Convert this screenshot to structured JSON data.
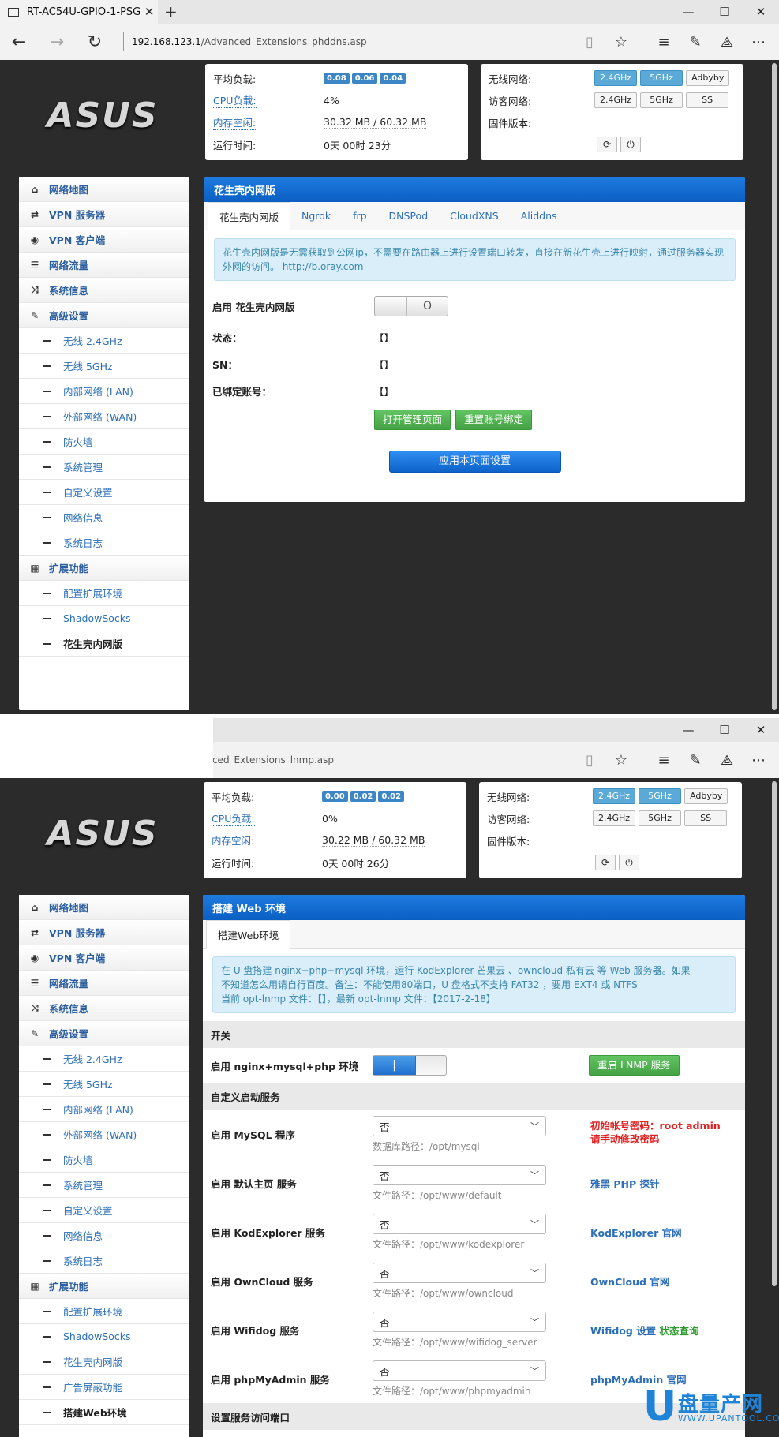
{
  "win1": {
    "tab_title": "RT-AC54U-GPIO-1-PSG",
    "url_host": "192.168.123.1",
    "url_path": "/Advanced_Extensions_phddns.asp",
    "logo": "ASUS",
    "status": {
      "load_label": "平均负载:",
      "load": [
        "0.08",
        "0.06",
        "0.04"
      ],
      "cpu_label": "CPU负载:",
      "cpu": "4%",
      "mem_label": "内存空闲:",
      "mem": "30.32 MB / 60.32 MB",
      "uptime_label": "运行时间:",
      "uptime": "0天 00时 23分"
    },
    "net": {
      "wireless_label": "无线网络:",
      "guest_label": "访客网络:",
      "fw_label": "固件版本:",
      "btn_24": "2.4GHz",
      "btn_5": "5GHz",
      "btn_adbyby": "Adbyby",
      "btn_ss": "SS"
    },
    "panel_title": "花生壳内网版",
    "tabs": [
      "花生壳内网版",
      "Ngrok",
      "frp",
      "DNSPod",
      "CloudXNS",
      "Aliddns"
    ],
    "info": "花生壳内网版是无需获取到公网ip，不需要在路由器上进行设置端口转发，直接在新花生壳上进行映射，通过服务器实现外网的访问。 http://b.oray.com",
    "enable_label": "启用 花生壳内网版",
    "toggle_off": "O",
    "status_label": "状态：",
    "sn_label": "SN：",
    "bound_label": "已绑定账号：",
    "bracket": "【】",
    "btn_open": "打开管理页面",
    "btn_reset": "重置账号绑定",
    "btn_apply": "应用本页面设置"
  },
  "win2": {
    "url_path": "anced_Extensions_lnmp.asp",
    "logo": "ASUS",
    "status": {
      "load": [
        "0.00",
        "0.02",
        "0.02"
      ],
      "cpu": "0%",
      "mem": "30.22 MB / 60.32 MB",
      "uptime": "0天 00时 26分"
    },
    "panel_title": "搭建 Web 环境",
    "tab": "搭建Web环境",
    "info_lines": [
      "在 U 盘搭建 nginx+php+mysql 环境，运行 KodExplorer 芒果云 、owncloud 私有云 等 Web 服务器。如果",
      "不知道怎么用请自行百度。备注：不能使用80端口，U 盘格式不支持 FAT32 ，要用 EXT4 或 NTFS",
      "当前 opt-lnmp 文件：【】，最新 opt-lnmp 文件：【2017-2-18】"
    ],
    "section_switch": "开关",
    "enable_label": "启用 nginx+mysql+php 环境",
    "toggle_on": "|",
    "btn_restart": "重启 LNMP 服务",
    "section_custom": "自定义启动服务",
    "section_port": "设置服务访问端口",
    "services": [
      {
        "label": "启用 MySQL 程序",
        "value": "否",
        "path": "数据库路径：/opt/mysql",
        "link": "初始帐号密码：root admin",
        "link2": "请手动修改密码"
      },
      {
        "label": "启用 默认主页 服务",
        "value": "否",
        "path": "文件路径：/opt/www/default",
        "link": "雅黑 PHP 探针"
      },
      {
        "label": "启用 KodExplorer 服务",
        "value": "否",
        "path": "文件路径：/opt/www/kodexplorer",
        "link": "KodExplorer 官网"
      },
      {
        "label": "启用 OwnCloud 服务",
        "value": "否",
        "path": "文件路径：/opt/www/owncloud",
        "link": "OwnCloud 官网"
      },
      {
        "label": "启用 Wifidog 服务",
        "value": "否",
        "path": "文件路径：/opt/www/wifidog_server",
        "link": "Wifidog 设置",
        "link2": "状态查询"
      },
      {
        "label": "启用 phpMyAdmin 服务",
        "value": "否",
        "path": "文件路径：/opt/www/phpmyadmin",
        "link": "phpMyAdmin 官网"
      }
    ]
  },
  "sidebar": {
    "main1": [
      "网络地图",
      "VPN 服务器",
      "VPN 客户端",
      "网络流量",
      "系统信息",
      "高级设置"
    ],
    "adv": [
      "无线 2.4GHz",
      "无线 5GHz",
      "内部网络 (LAN)",
      "外部网络 (WAN)",
      "防火墙",
      "系统管理",
      "自定义设置",
      "网络信息",
      "系统日志"
    ],
    "ext_label": "扩展功能",
    "ext1": [
      "配置扩展环境",
      "ShadowSocks",
      "花生壳内网版"
    ],
    "ext2": [
      "配置扩展环境",
      "ShadowSocks",
      "花生壳内网版",
      "广告屏蔽功能",
      "搭建Web环境"
    ]
  },
  "watermark": {
    "u": "U",
    "cn": "盘量产网",
    "en": "WWW.UPANTOOL.COM"
  }
}
